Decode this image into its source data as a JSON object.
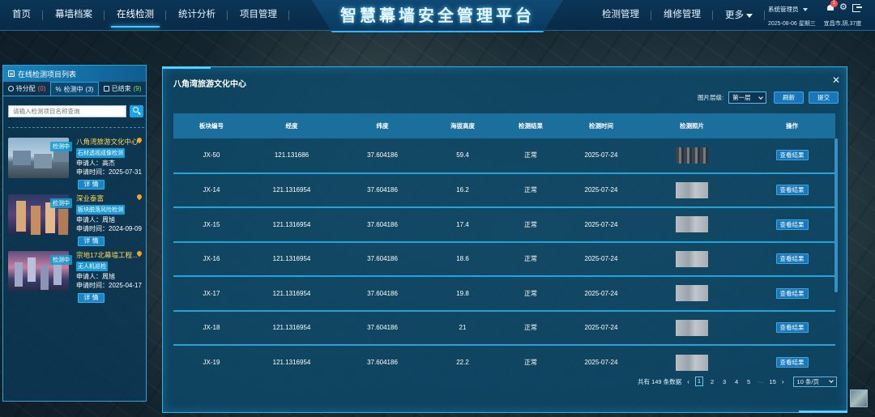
{
  "header": {
    "title": "智慧幕墙安全管理平台",
    "nav_left": [
      "首页",
      "幕墙档案",
      "在线检测",
      "统计分析",
      "项目管理"
    ],
    "nav_right": [
      "检测管理",
      "维修管理"
    ],
    "more_label": "更多",
    "user_name": "系统管理员",
    "notify_count": "1",
    "date": "2025-08-06 星期三",
    "weather": "宜昌市,阴,37度"
  },
  "left_panel": {
    "title": "在线检测项目列表",
    "tabs": [
      {
        "label": "待分配",
        "count": "(0)"
      },
      {
        "label": "检测中",
        "count": "(3)"
      },
      {
        "label": "已结束",
        "count": "(9)"
      }
    ],
    "search_placeholder": "请输入检测项目名称查询",
    "detail_label": "详 情",
    "cards": [
      {
        "status": "检测中",
        "name": "八角湾旅游文化中心",
        "type": "石材透视成像检测",
        "applicant": "申请人：高杰",
        "time": "申请时间：2025-07-31"
      },
      {
        "status": "检测中",
        "name": "深业泰富",
        "type": "板块脱落风险检测",
        "applicant": "申请人：周旭",
        "time": "申请时间：2024-09-09"
      },
      {
        "status": "检测中",
        "name": "宗地17北幕墙工程...",
        "type": "无人机巡检",
        "applicant": "申请人：周旭",
        "time": "申请时间：2025-04-17"
      }
    ]
  },
  "dialog": {
    "title": "八角湾旅游文化中心",
    "layer_label": "图片层级:",
    "layer_value": "第一层",
    "refresh_label": "刷新",
    "submit_label": "提交",
    "columns": [
      "板块编号",
      "经度",
      "纬度",
      "海拔高度",
      "检测结果",
      "检测时间",
      "检测照片",
      "操作"
    ],
    "action_label": "查看结果",
    "rows": [
      {
        "id": "JX-50",
        "lng": "121.131686",
        "lat": "37.604186",
        "alt": "59.4",
        "result": "正常",
        "time": "2025-07-24"
      },
      {
        "id": "JX-14",
        "lng": "121.1316954",
        "lat": "37.604186",
        "alt": "16.2",
        "result": "正常",
        "time": "2025-07-24"
      },
      {
        "id": "JX-15",
        "lng": "121.1316954",
        "lat": "37.604186",
        "alt": "17.4",
        "result": "正常",
        "time": "2025-07-24"
      },
      {
        "id": "JX-16",
        "lng": "121.1316954",
        "lat": "37.604186",
        "alt": "18.6",
        "result": "正常",
        "time": "2025-07-24"
      },
      {
        "id": "JX-17",
        "lng": "121.1316954",
        "lat": "37.604186",
        "alt": "19.8",
        "result": "正常",
        "time": "2025-07-24"
      },
      {
        "id": "JX-18",
        "lng": "121.1316954",
        "lat": "37.604186",
        "alt": "21",
        "result": "正常",
        "time": "2025-07-24"
      },
      {
        "id": "JX-19",
        "lng": "121.1316954",
        "lat": "37.604186",
        "alt": "22.2",
        "result": "正常",
        "time": "2025-07-24"
      }
    ],
    "pagination": {
      "total": "共有 149 条数据",
      "pages": [
        "1",
        "2",
        "3",
        "4",
        "5"
      ],
      "ellipsis": "···",
      "last_page": "15",
      "page_size": "10 条/页"
    }
  }
}
